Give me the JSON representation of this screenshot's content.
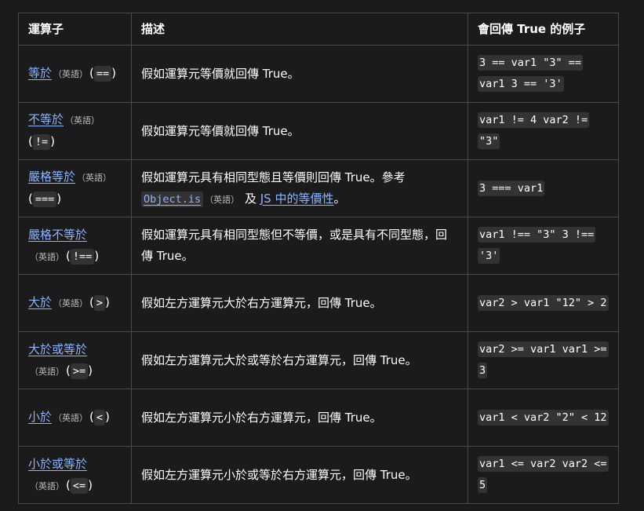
{
  "headers": [
    "運算子",
    "描述",
    "會回傳 True 的例子"
  ],
  "english_tag": "（英語）",
  "rows": [
    {
      "name": "等於",
      "symbol": "==",
      "description": "假如運算元等價就回傳 True。",
      "example": "3 == var1 \"3\" == var1 3 == '3'"
    },
    {
      "name": "不等於",
      "symbol": "!=",
      "description": "假如運算元等價就回傳 True。",
      "example": "var1 != 4 var2 != \"3\""
    },
    {
      "name": "嚴格等於",
      "symbol": "===",
      "description_prefix": "假如運算元具有相同型態且等價則回傳 True。參考",
      "description_link1": "Object.is",
      "description_mid": "及",
      "description_link2": "JS 中的等價性",
      "description_suffix": "。",
      "example": "3 === var1"
    },
    {
      "name": "嚴格不等於",
      "symbol": "!==",
      "description": "假如運算元具有相同型態但不等價，或是具有不同型態，回傳 True。",
      "example": "var1 !== \"3\" 3 !== '3'"
    },
    {
      "name": "大於",
      "symbol": ">",
      "description": "假如左方運算元大於右方運算元，回傳 True。",
      "example": "var2 > var1 \"12\" > 2"
    },
    {
      "name": "大於或等於",
      "symbol": ">=",
      "description": "假如左方運算元大於或等於右方運算元，回傳 True。",
      "example": "var2 >= var1 var1 >= 3"
    },
    {
      "name": "小於",
      "symbol": "<",
      "description": "假如左方運算元小於右方運算元，回傳 True。",
      "example": "var1 < var2 \"2\" < 12"
    },
    {
      "name": "小於或等於",
      "symbol": "<=",
      "description": "假如左方運算元小於或等於右方運算元，回傳 True。",
      "example": "var1 <= var2 var2 <= 5"
    }
  ]
}
